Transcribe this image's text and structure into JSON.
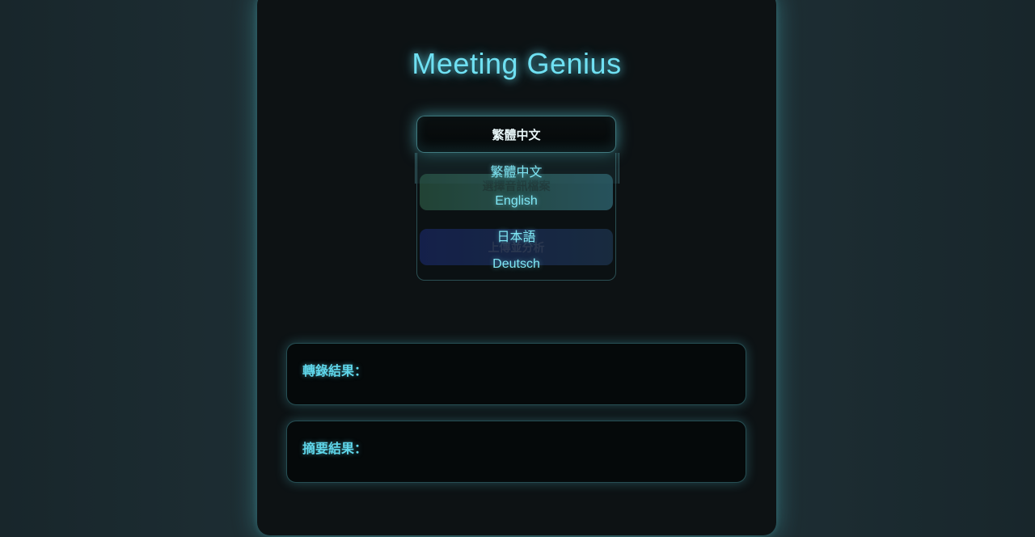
{
  "app": {
    "title": "Meeting Genius"
  },
  "language_select": {
    "selected": "繁體中文",
    "options": [
      "繁體中文",
      "English",
      "日本語",
      "Deutsch"
    ]
  },
  "buttons": {
    "choose_file": "選擇音訊檔案",
    "upload_analyze": "上傳並分析"
  },
  "results": {
    "transcript_label": "轉錄結果：",
    "summary_label": "摘要結果："
  },
  "colors": {
    "accent": "#6fe0f2",
    "panel": "#0d1214",
    "background": "#1d2b30"
  }
}
